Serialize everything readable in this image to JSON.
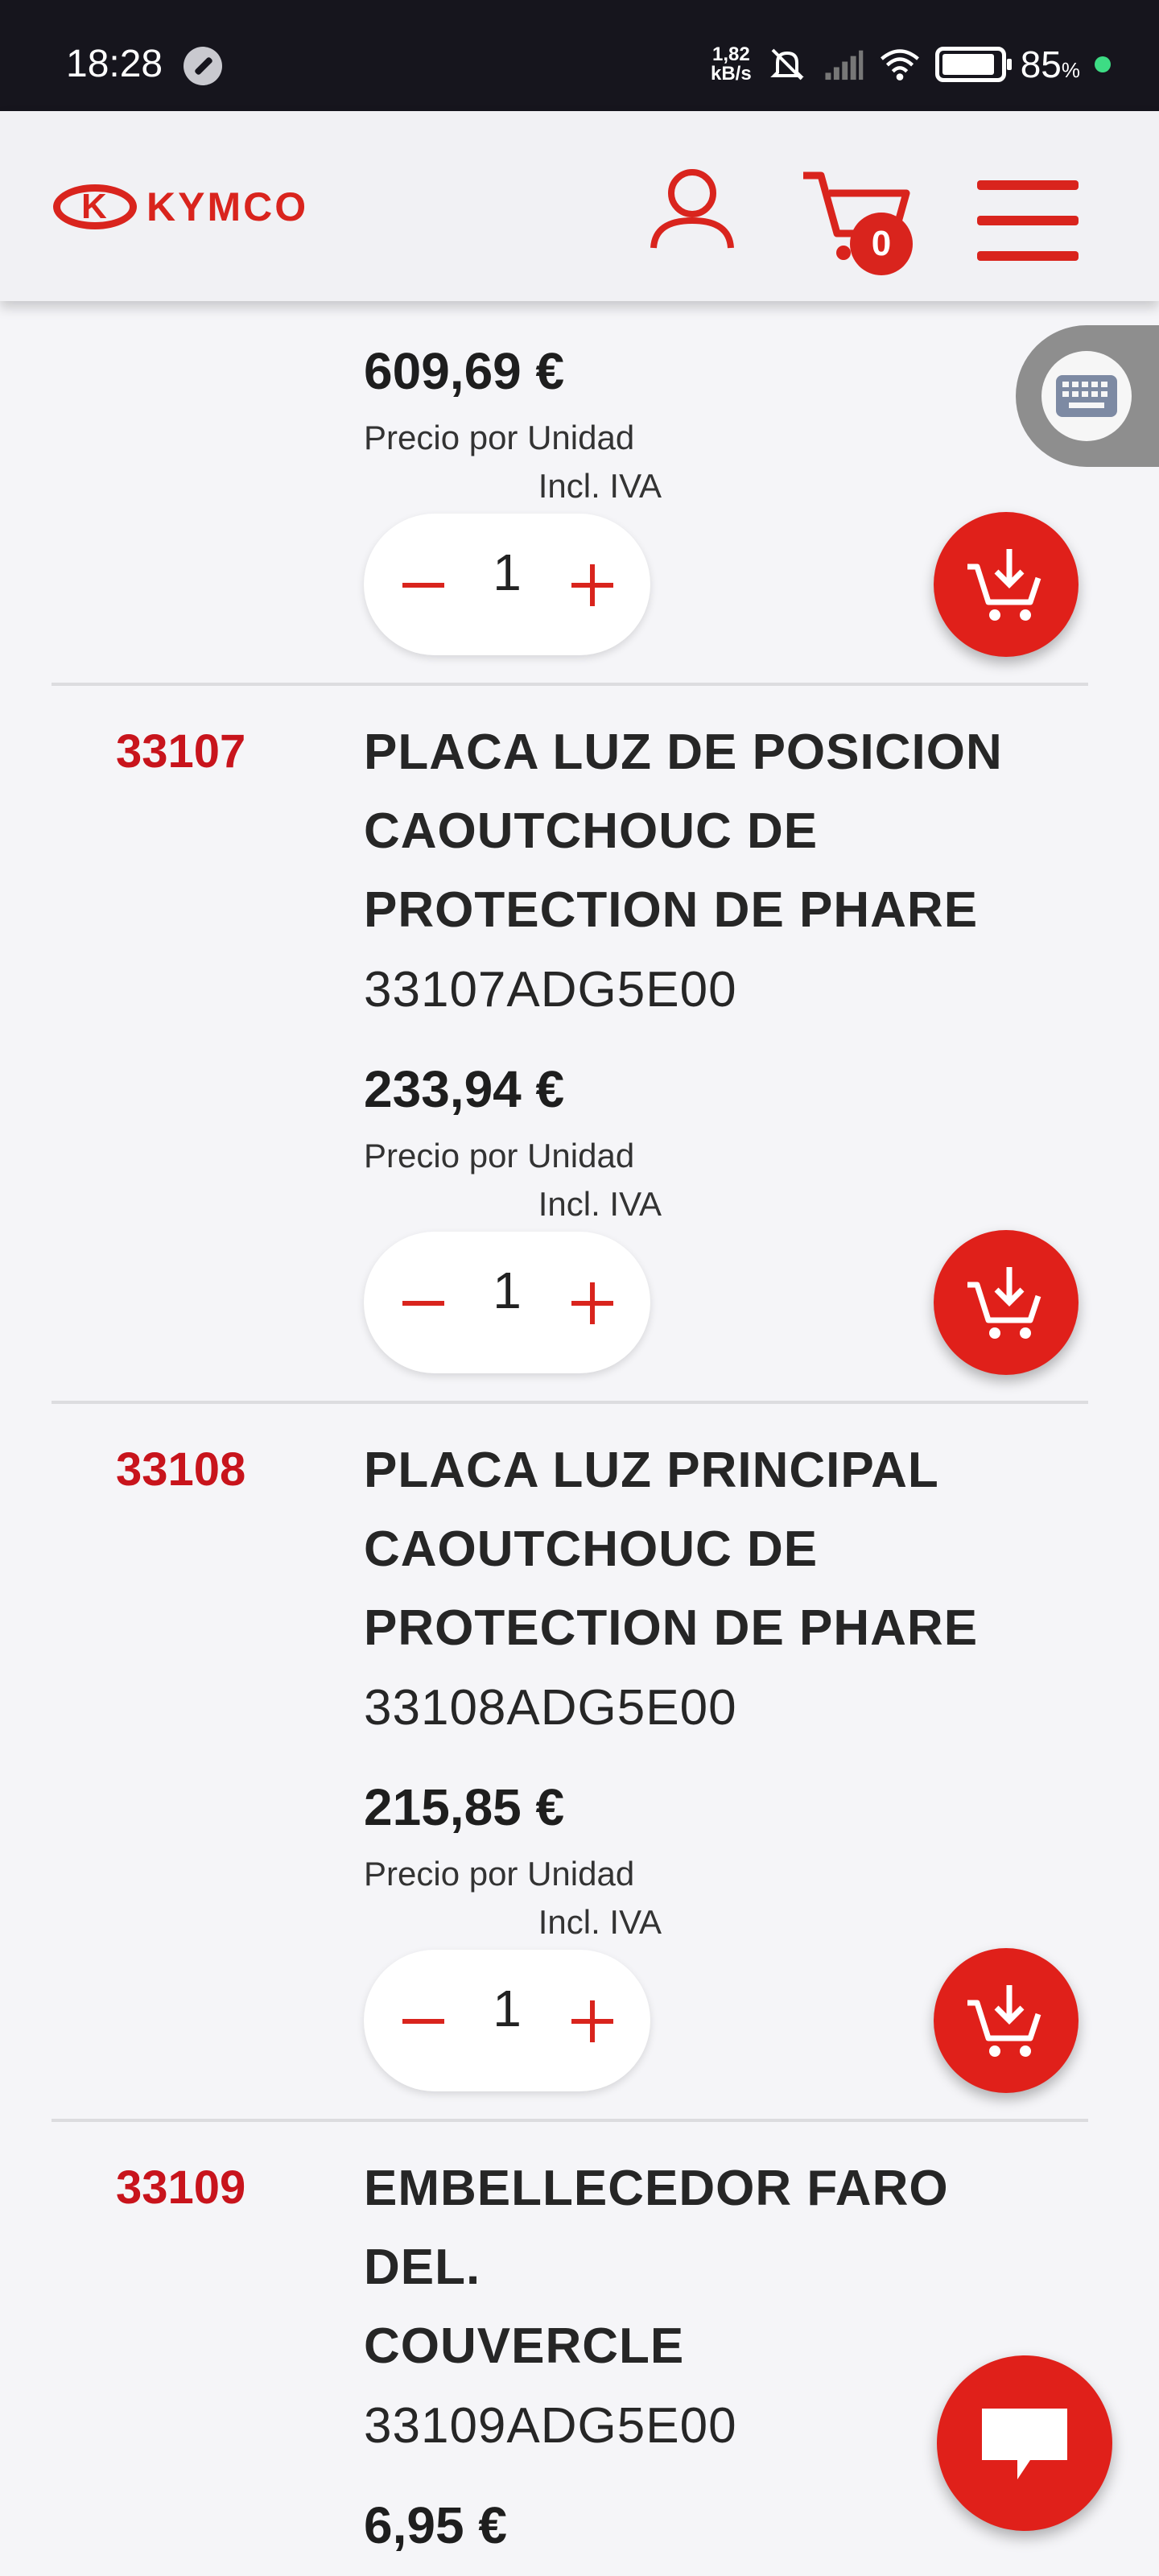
{
  "status_bar": {
    "time": "18:28",
    "net_speed_value": "1,82",
    "net_speed_unit": "kB/s",
    "battery_percent": "85",
    "battery_symbol": "%"
  },
  "header": {
    "logo_text": "KYMCO",
    "cart_count": "0",
    "icons": [
      "user-icon",
      "cart-icon",
      "menu-icon"
    ]
  },
  "products": [
    {
      "code": "",
      "name_lines": [],
      "ref": "",
      "price": "609,69 €",
      "unit_label": "Precio por Unidad",
      "vat_label": "Incl. IVA",
      "quantity": "1"
    },
    {
      "code": "33107",
      "name_lines": [
        "PLACA LUZ DE POSICION",
        "CAOUTCHOUC DE",
        "PROTECTION DE PHARE"
      ],
      "ref": "33107ADG5E00",
      "price": "233,94 €",
      "unit_label": "Precio por Unidad",
      "vat_label": "Incl. IVA",
      "quantity": "1"
    },
    {
      "code": "33108",
      "name_lines": [
        "PLACA LUZ PRINCIPAL",
        "CAOUTCHOUC DE",
        "PROTECTION DE PHARE"
      ],
      "ref": "33108ADG5E00",
      "price": "215,85 €",
      "unit_label": "Precio por Unidad",
      "vat_label": "Incl. IVA",
      "quantity": "1"
    },
    {
      "code": "33109",
      "name_lines": [
        "EMBELLECEDOR FARO",
        "DEL.",
        "COUVERCLE"
      ],
      "ref": "33109ADG5E00",
      "price": "6,95 €"
    }
  ],
  "colors": {
    "accent": "#d9241d",
    "code_red": "#c8141c",
    "background": "#f5f5f8",
    "status_bar": "#16151d"
  }
}
